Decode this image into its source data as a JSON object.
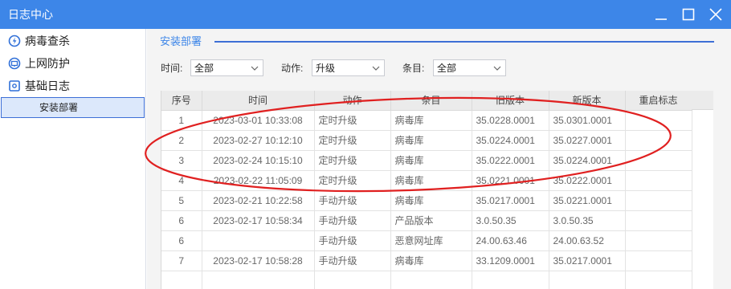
{
  "window": {
    "title": "日志中心",
    "accent": "#3d86e8",
    "controls": [
      "minimize-icon",
      "maximize-icon",
      "close-icon"
    ]
  },
  "sidebar": {
    "items": [
      {
        "label": "病毒查杀",
        "icon": "virus-scan-icon"
      },
      {
        "label": "上网防护",
        "icon": "web-protection-icon"
      },
      {
        "label": "基础日志",
        "icon": "log-icon"
      }
    ],
    "selected_sub": "安装部署"
  },
  "section": {
    "title": "安装部署"
  },
  "filters": {
    "time": {
      "label": "时间:",
      "value": "全部"
    },
    "action": {
      "label": "动作:",
      "value": "升级"
    },
    "item": {
      "label": "条目:",
      "value": "全部"
    }
  },
  "table": {
    "columns": [
      "序号",
      "时间",
      "动作",
      "条目",
      "旧版本",
      "新版本",
      "重启标志"
    ],
    "rows": [
      {
        "seq": "1",
        "time": "2023-03-01 10:33:08",
        "action": "定时升级",
        "item": "病毒库",
        "old": "35.0228.0001",
        "new": "35.0301.0001",
        "restart": ""
      },
      {
        "seq": "2",
        "time": "2023-02-27 10:12:10",
        "action": "定时升级",
        "item": "病毒库",
        "old": "35.0224.0001",
        "new": "35.0227.0001",
        "restart": ""
      },
      {
        "seq": "3",
        "time": "2023-02-24 10:15:10",
        "action": "定时升级",
        "item": "病毒库",
        "old": "35.0222.0001",
        "new": "35.0224.0001",
        "restart": ""
      },
      {
        "seq": "4",
        "time": "2023-02-22 11:05:09",
        "action": "定时升级",
        "item": "病毒库",
        "old": "35.0221.0001",
        "new": "35.0222.0001",
        "restart": ""
      },
      {
        "seq": "5",
        "time": "2023-02-21 10:22:58",
        "action": "手动升级",
        "item": "病毒库",
        "old": "35.0217.0001",
        "new": "35.0221.0001",
        "restart": ""
      },
      {
        "seq": "6",
        "time": "2023-02-17 10:58:34",
        "action": "手动升级",
        "item": "产品版本",
        "old": "3.0.50.35",
        "new": "3.0.50.35",
        "restart": ""
      },
      {
        "seq": "6",
        "time": "",
        "action": "手动升级",
        "item": "恶意网址库",
        "old": "24.00.63.46",
        "new": "24.00.63.52",
        "restart": ""
      },
      {
        "seq": "7",
        "time": "2023-02-17 10:58:28",
        "action": "手动升级",
        "item": "病毒库",
        "old": "33.1209.0001",
        "new": "35.0217.0001",
        "restart": ""
      },
      {
        "seq": "",
        "time": "",
        "action": "",
        "item": "",
        "old": "",
        "new": "",
        "restart": ""
      }
    ]
  },
  "annotation": {
    "shape": "ellipse",
    "color": "#e02020",
    "highlights_rows": [
      "1",
      "2",
      "3",
      "4"
    ]
  }
}
